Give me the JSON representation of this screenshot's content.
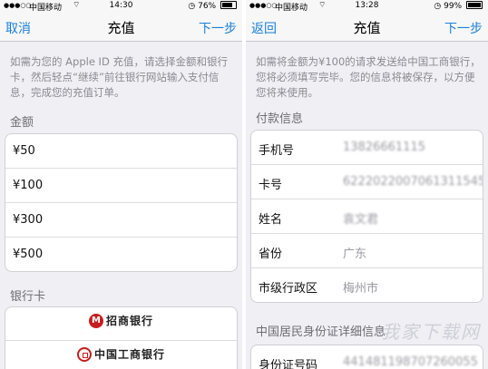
{
  "left": {
    "status": {
      "carrier": "中国移动",
      "time": "14:30",
      "battery": "76%",
      "battery_level": 0.76
    },
    "nav": {
      "left": "取消",
      "title": "充值",
      "right": "下一步"
    },
    "description": "如需为您的 Apple ID 充值，请选择金额和银行卡，然后轻点“继续”前往银行网站输入支付信息，完成您的充值订单。",
    "amount_header": "金额",
    "amounts": [
      "¥50",
      "¥100",
      "¥300",
      "¥500"
    ],
    "bank_header": "银行卡",
    "banks": [
      {
        "name": "招商银行",
        "icon": "cmb-logo-icon"
      },
      {
        "name": "中国工商银行",
        "icon": "icbc-logo-icon"
      }
    ]
  },
  "right": {
    "status": {
      "carrier": "中国移动",
      "time": "13:28",
      "battery": "99%",
      "battery_level": 0.99
    },
    "nav": {
      "left": "返回",
      "title": "充值",
      "right": "下一步"
    },
    "description": "如需将金额为¥100的请求发送给中国工商银行，您将必须填写完毕。您的信息将被保存，以方便您将来使用。",
    "payment_header": "付款信息",
    "payment_rows": [
      {
        "label": "手机号",
        "value": "13826661115"
      },
      {
        "label": "卡号",
        "value": "6222022007061311545"
      },
      {
        "label": "姓名",
        "value": "袁文君"
      },
      {
        "label": "省份",
        "value": "广东"
      },
      {
        "label": "市级行政区",
        "value": "梅州市"
      }
    ],
    "id_header": "中国居民身份证详细信息",
    "id_rows": [
      {
        "label": "身份证号码",
        "value": "441481198707260055"
      }
    ],
    "watermark": "我家下载网"
  }
}
